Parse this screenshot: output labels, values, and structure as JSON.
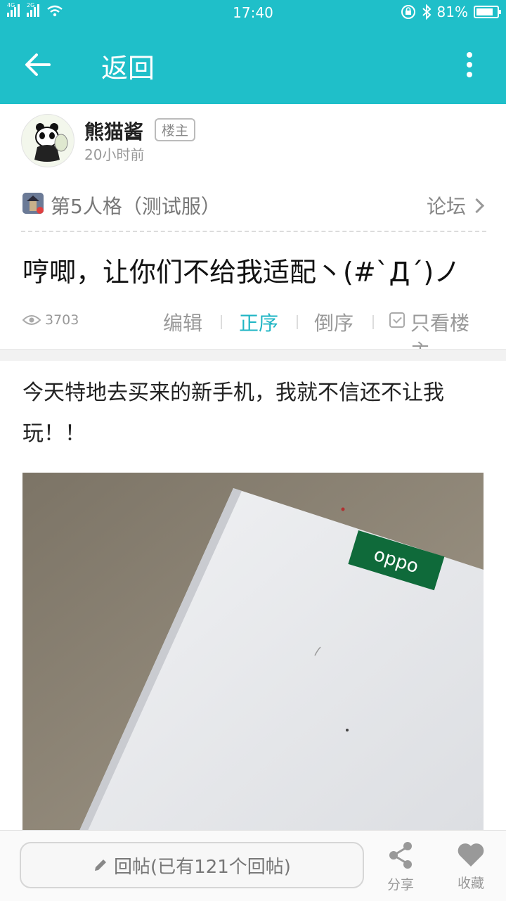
{
  "status_bar": {
    "net1": "4G",
    "net2": "2G",
    "time": "17:40",
    "battery": "81%",
    "battery_level": 0.81
  },
  "app_bar": {
    "back_label": "返回"
  },
  "post": {
    "author": "熊猫酱",
    "op_badge": "楼主",
    "time": "20小时前",
    "forum_name": "第5人格（测试服）",
    "forum_link": "论坛",
    "title": "哼唧，让你们不给我适配丶(#`Д´)ノ",
    "views": "3703",
    "options": {
      "edit": "编辑",
      "order_asc": "正序",
      "order_desc": "倒序",
      "only_op": "只看楼主"
    },
    "body": "今天特地去买来的新手机，我就不信还不让我玩！！",
    "photo_brand": "oppo"
  },
  "bottom_bar": {
    "reply_placeholder": "回帖(已有121个回帖)",
    "share_label": "分享",
    "fav_label": "收藏"
  },
  "colors": {
    "accent": "#1fbfc9",
    "active_tab": "#1fb5c4"
  },
  "icons": [
    "back-arrow-icon",
    "more-vertical-icon",
    "eye-icon",
    "chevron-right-icon",
    "checkbox-icon",
    "pencil-icon",
    "share-icon",
    "heart-icon"
  ]
}
